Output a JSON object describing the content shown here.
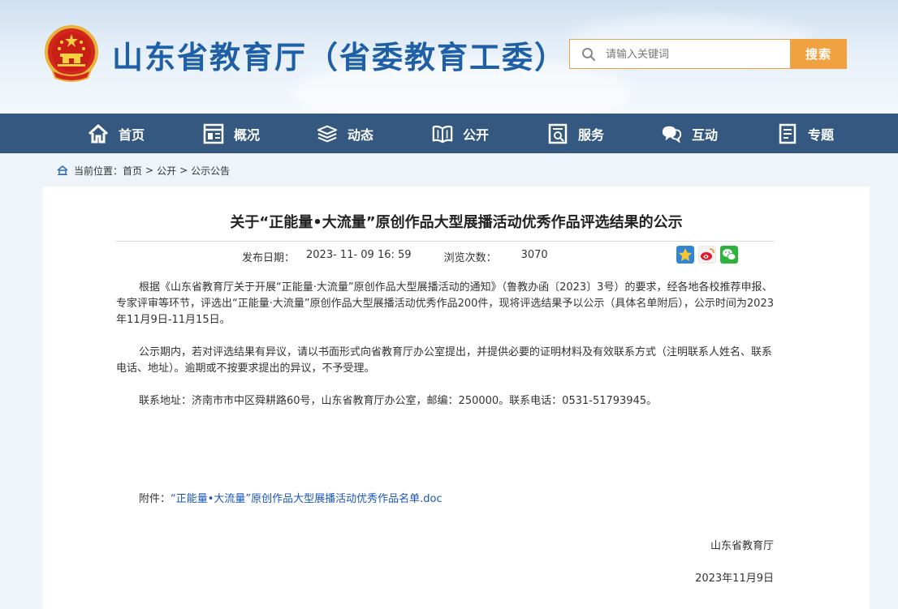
{
  "header": {
    "site_title": "山东省教育厅（省委教育工委）",
    "search_placeholder": "请输入关键词",
    "search_button": "搜索"
  },
  "nav": {
    "items": [
      {
        "label": "首页",
        "icon": "home-icon"
      },
      {
        "label": "概况",
        "icon": "overview-icon"
      },
      {
        "label": "动态",
        "icon": "news-stack-icon"
      },
      {
        "label": "公开",
        "icon": "open-book-icon"
      },
      {
        "label": "服务",
        "icon": "service-icon"
      },
      {
        "label": "互动",
        "icon": "chat-icon"
      },
      {
        "label": "专题",
        "icon": "topic-icon"
      }
    ]
  },
  "breadcrumb": {
    "prefix": "当前位置：",
    "items": [
      "首页",
      "公开",
      "公示公告"
    ],
    "separator": ">"
  },
  "article": {
    "title": "关于“正能量•大流量”原创作品大型展播活动优秀作品评选结果的公示",
    "publish_label": "发布日期：",
    "publish_date": "2023- 11- 09 16: 59",
    "views_label": "浏览次数：",
    "views": "3070",
    "share_icons": [
      "qzone-star-icon",
      "weibo-icon",
      "wechat-icon"
    ],
    "paragraphs": [
      "根据《山东省教育厅关于开展“正能量·大流量”原创作品大型展播活动的通知》（鲁教办函〔2023〕3号）的要求，经各地各校推荐申报、专家评审等环节，评选出“正能量·大流量”原创作品大型展播活动优秀作品200件，现将评选结果予以公示（具体名单附后），公示时间为2023年11月9日-11月15日。",
      "公示期内，若对评选结果有异议，请以书面形式向省教育厅办公室提出，并提供必要的证明材料及有效联系方式（注明联系人姓名、联系电话、地址）。逾期或不按要求提出的异议，不予受理。",
      "联系地址：济南市市中区舜耕路60号，山东省教育厅办公室，邮编：250000。联系电话：0531-51793945。"
    ],
    "attachment_label": "附件：",
    "attachment_link": "“正能量•大流量”原创作品大型展播活动优秀作品名单.doc",
    "signature": "山东省教育厅",
    "signature_date": "2023年11月9日"
  },
  "colors": {
    "title_blue": "#1f5fa6",
    "nav_bg": "#34587f",
    "search_orange": "#f0a240",
    "link_blue": "#1a56b8"
  }
}
